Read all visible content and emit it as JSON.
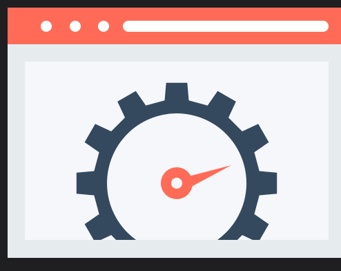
{
  "colors": {
    "background": "#1f1f22",
    "window_frame": "#e6ebee",
    "titlebar": "#ff6b57",
    "panel": "#f5f7fa",
    "gear": "#34495e",
    "needle": "#ff6b57",
    "dots": "#ffffff"
  },
  "icons": {
    "window_buttons": [
      "window-dot-icon",
      "window-dot-icon",
      "window-dot-icon"
    ],
    "illustration": "gear-speedometer-icon"
  }
}
